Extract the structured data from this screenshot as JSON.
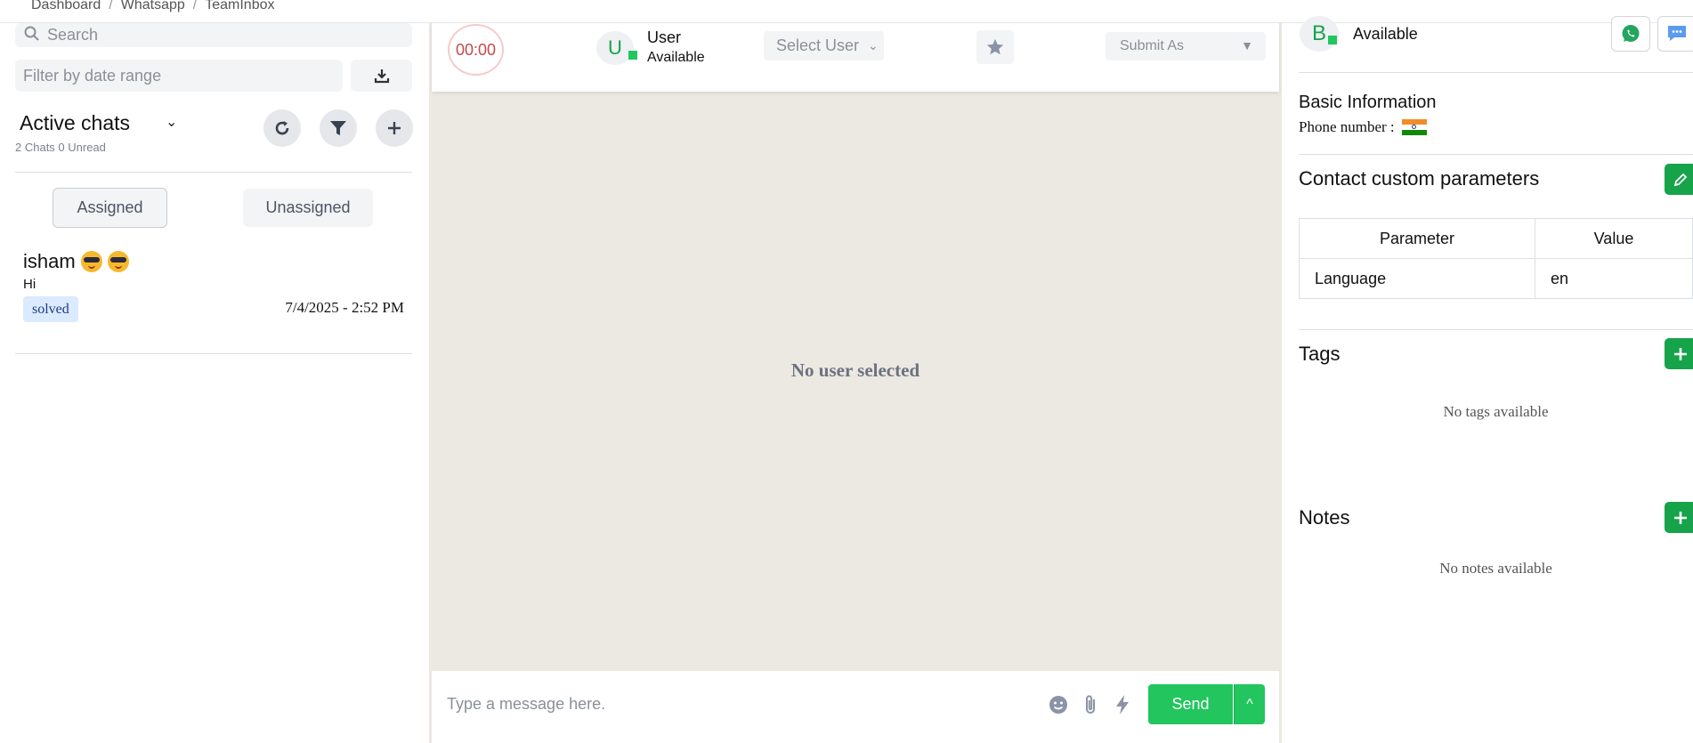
{
  "breadcrumb": [
    "Dashboard",
    "Whatsapp",
    "TeamInbox"
  ],
  "left": {
    "search_placeholder": "Search",
    "date_placeholder": "Filter by date range",
    "active_title": "Active chats",
    "chats_count": "2 Chats 0 Unread",
    "tabs": {
      "assigned": "Assigned",
      "unassigned": "Unassigned"
    },
    "chats": [
      {
        "name": "isham",
        "preview": "Hi",
        "status": "solved",
        "time": "7/4/2025 - 2:52 PM"
      }
    ]
  },
  "center": {
    "timer": "00:00",
    "user_initial": "U",
    "user_name": "User",
    "user_status": "Available",
    "select_user": "Select User",
    "submit_as": "Submit As",
    "empty_message": "No user selected",
    "message_placeholder": "Type a message here.",
    "send_label": "Send",
    "send_more": "^"
  },
  "right": {
    "avatar_initial": "B",
    "status": "Available",
    "basic_info_title": "Basic Information",
    "phone_label": "Phone number :",
    "custom_params_title": "Contact custom parameters",
    "param_headers": [
      "Parameter",
      "Value"
    ],
    "params": [
      {
        "name": "Language",
        "value": "en"
      }
    ],
    "tags_title": "Tags",
    "tags_empty": "No tags available",
    "notes_title": "Notes",
    "notes_empty": "No notes available"
  },
  "colors": {
    "accent_green": "#22c55e",
    "status_badge_bg": "#dbeafe",
    "chat_background": "#ece8e2",
    "timer_red": "#c24a4a"
  },
  "icons": [
    "search-icon",
    "download-icon",
    "chevron-down-icon",
    "refresh-icon",
    "filter-icon",
    "plus-icon",
    "star-icon",
    "emoji-icon",
    "paperclip-icon",
    "lightning-icon",
    "whatsapp-icon",
    "chat-bubble-icon",
    "edit-icon",
    "india-flag-icon"
  ]
}
